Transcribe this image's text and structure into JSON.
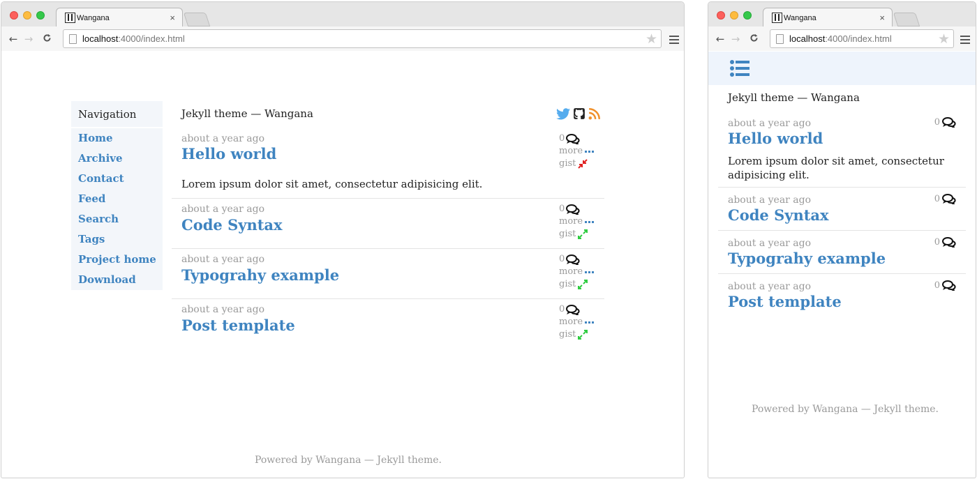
{
  "browser": {
    "tab_title": "Wangana",
    "tab_close": "×",
    "url_host": "localhost",
    "url_path": ":4000/index.html",
    "back": "←",
    "forward": "→",
    "reload": "C",
    "star": "★"
  },
  "nav": {
    "heading": "Navigation",
    "items": [
      "Home",
      "Archive",
      "Contact",
      "Feed",
      "Search",
      "Tags",
      "Project home",
      "Download"
    ]
  },
  "site": {
    "title": "Jekyll theme — Wangana",
    "footer": "Powered by Wangana — Jekyll theme."
  },
  "social": [
    "twitter-icon",
    "github-icon",
    "rss-icon"
  ],
  "meta_labels": {
    "more": "more",
    "gist": "gist"
  },
  "posts": [
    {
      "date": "about a year ago",
      "title": "Hello world",
      "excerpt": "Lorem ipsum dolor sit amet, consectetur adipisicing elit.",
      "comments": "0",
      "gist_state": "collapse"
    },
    {
      "date": "about a year ago",
      "title": "Code Syntax",
      "excerpt": "",
      "comments": "0",
      "gist_state": "expand"
    },
    {
      "date": "about a year ago",
      "title": "Typograhy example",
      "excerpt": "",
      "comments": "0",
      "gist_state": "expand"
    },
    {
      "date": "about a year ago",
      "title": "Post template",
      "excerpt": "",
      "comments": "0",
      "gist_state": "expand"
    }
  ],
  "mobile": {
    "excerpt_line1": "Lorem ipsum dolor sit amet, consectetur",
    "excerpt_line2": "adipisicing elit."
  },
  "colors": {
    "link": "#3f84c0",
    "muted": "#9a9a9a",
    "gist_collapse": "#e02020",
    "gist_expand": "#2ecc40",
    "rss": "#f0902a",
    "twitter": "#55acee"
  }
}
